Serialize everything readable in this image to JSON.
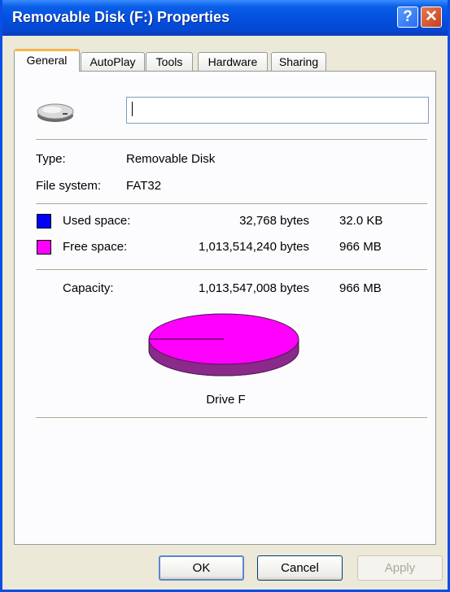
{
  "window": {
    "title": "Removable Disk (F:) Properties",
    "help_symbol": "?",
    "close_symbol": "✕"
  },
  "tabs": [
    {
      "label": "General",
      "active": true
    },
    {
      "label": "AutoPlay",
      "active": false
    },
    {
      "label": "Tools",
      "active": false
    },
    {
      "label": "Hardware",
      "active": false
    },
    {
      "label": "Sharing",
      "active": false
    }
  ],
  "general": {
    "drive_icon": "removable-drive-icon",
    "name_value": "",
    "type_label": "Type:",
    "type_value": "Removable Disk",
    "fs_label": "File system:",
    "fs_value": "FAT32",
    "used_label": "Used space:",
    "used_bytes": "32,768 bytes",
    "used_size": "32.0 KB",
    "free_label": "Free space:",
    "free_bytes": "1,013,514,240 bytes",
    "free_size": "966 MB",
    "capacity_label": "Capacity:",
    "capacity_bytes": "1,013,547,008 bytes",
    "capacity_size": "966 MB",
    "drive_label": "Drive F"
  },
  "colors": {
    "used": "#0000ff",
    "free": "#ff00ff",
    "free_shadow": "#8a2a8a"
  },
  "buttons": {
    "ok": "OK",
    "cancel": "Cancel",
    "apply": "Apply"
  }
}
